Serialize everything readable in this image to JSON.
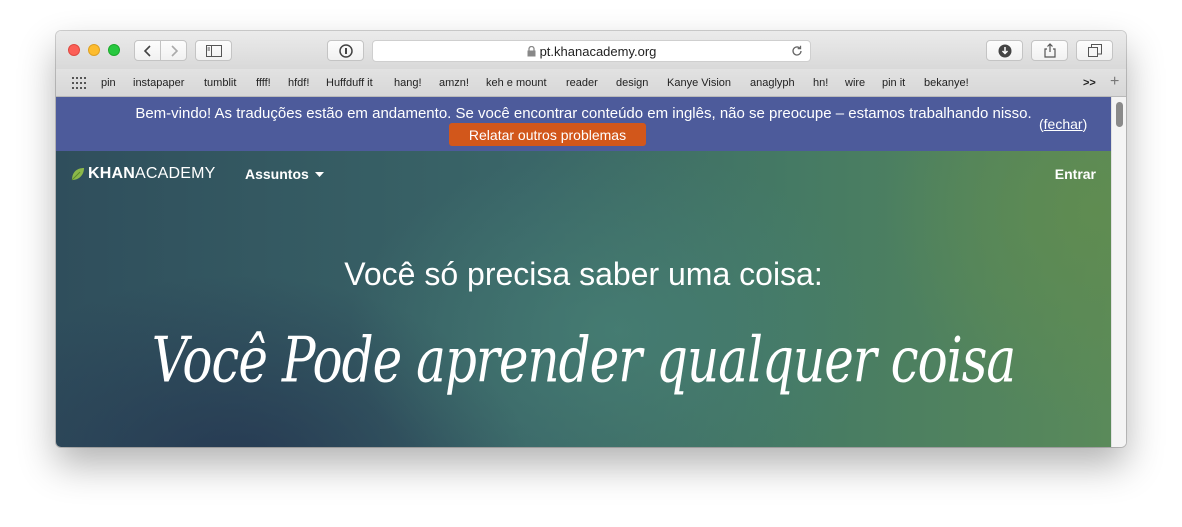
{
  "browser": {
    "url": "pt.khanacademy.org",
    "bookmarks": [
      "pin",
      "instapaper",
      "tumblit",
      "ffff!",
      "hfdf!",
      "Huffduff it",
      "hang!",
      "amzn!",
      "keh e mount",
      "reader",
      "design",
      "Kanye Vision",
      "anaglyph",
      "hn!",
      "wire",
      "pin it",
      "bekanye!"
    ],
    "overflow_label": ">>",
    "add_label": "+"
  },
  "banner": {
    "message": "Bem-vindo! As traduções estão em andamento. Se você encontrar conteúdo em inglês, não se preocupe – estamos trabalhando nisso.",
    "report_button": "Relatar outros problemas",
    "close_label": "fechar",
    "close_open": "(",
    "close_close": ")",
    "color": "#4d5b9b",
    "button_color": "#d2571b"
  },
  "nav": {
    "logo_bold": "KHAN",
    "logo_light": "ACADEMY",
    "subjects": "Assuntos",
    "login": "Entrar"
  },
  "hero": {
    "tagline": "Você só precisa saber uma coisa:",
    "script": "Você Pode aprender qualquer coisa"
  }
}
